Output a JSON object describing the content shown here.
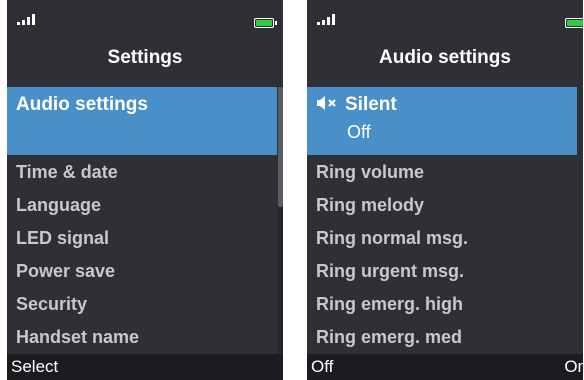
{
  "left_screen": {
    "title": "Settings",
    "selected": {
      "label": "Audio settings"
    },
    "items": [
      {
        "label": "Time & date"
      },
      {
        "label": "Language"
      },
      {
        "label": "LED signal"
      },
      {
        "label": "Power save"
      },
      {
        "label": "Security"
      },
      {
        "label": "Handset name"
      }
    ],
    "softkeys": {
      "left": "Select"
    },
    "scroll_position": 0
  },
  "right_screen": {
    "title": "Audio settings",
    "selected": {
      "label": "Silent",
      "value": "Off",
      "icon": "speaker-muted-icon"
    },
    "items": [
      {
        "label": "Ring volume"
      },
      {
        "label": "Ring melody"
      },
      {
        "label": "Ring normal msg."
      },
      {
        "label": "Ring urgent msg."
      },
      {
        "label": "Ring emerg. high"
      },
      {
        "label": "Ring emerg. med"
      }
    ],
    "softkeys": {
      "left": "Off",
      "right": "On"
    }
  },
  "colors": {
    "background": "#2e3035",
    "highlight": "#4a90c8",
    "battery": "#2ecc40",
    "item_text": "#c8c8c8"
  }
}
